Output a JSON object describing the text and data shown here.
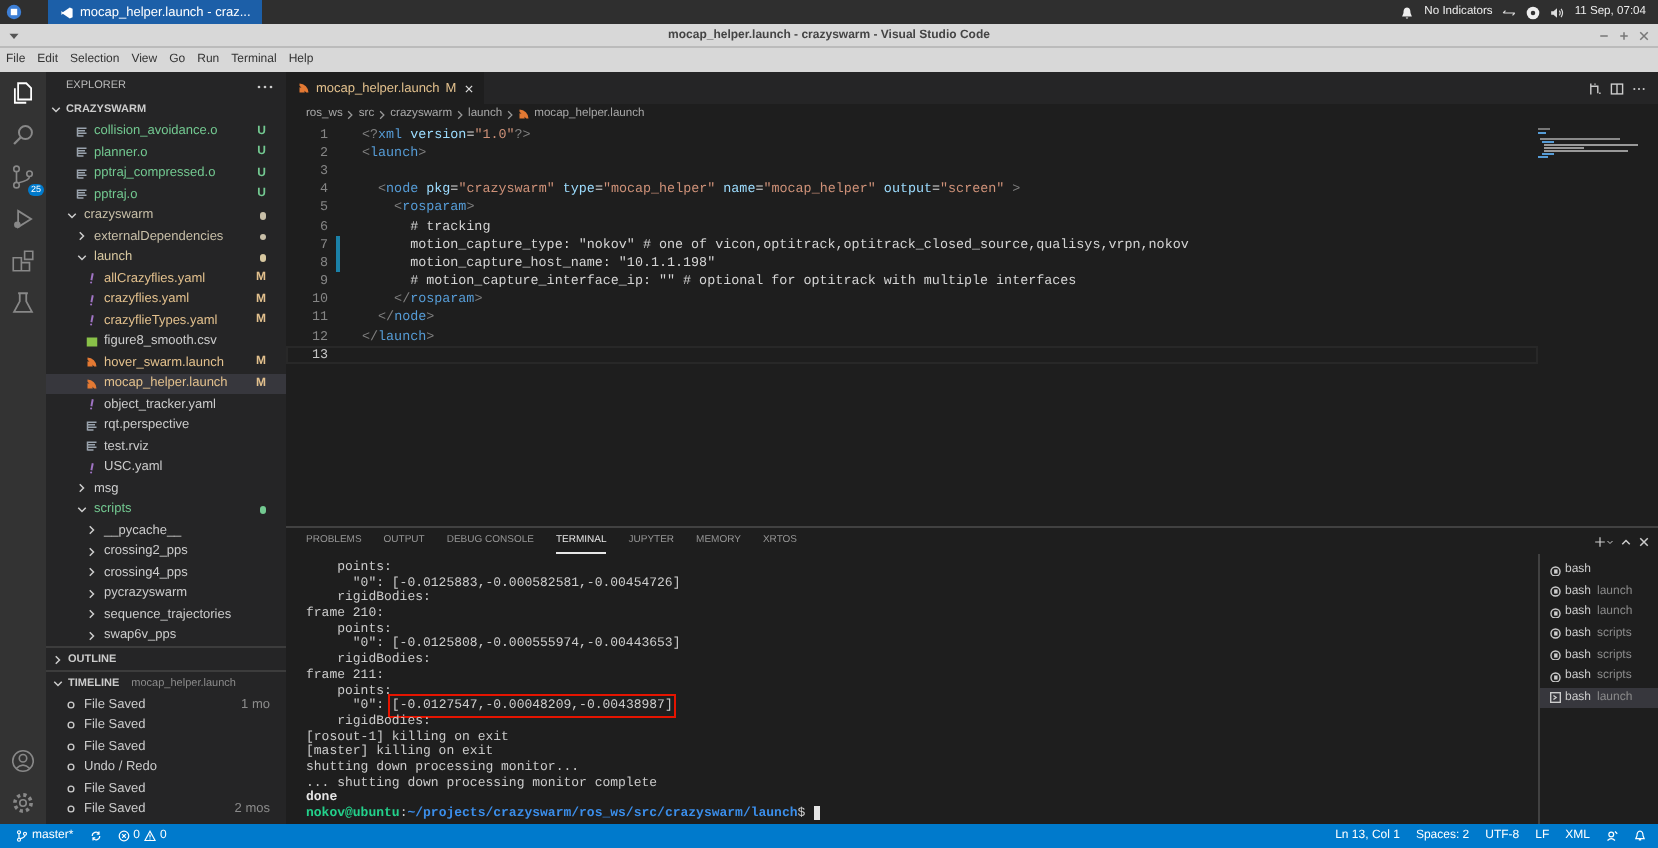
{
  "top_panel": {
    "taskbar_item": "mocap_helper.launch - craz...",
    "indicators": "No Indicators",
    "clock": "11 Sep, 07:04"
  },
  "window": {
    "title": "mocap_helper.launch - crazyswarm - Visual Studio Code"
  },
  "menu": [
    "File",
    "Edit",
    "Selection",
    "View",
    "Go",
    "Run",
    "Terminal",
    "Help"
  ],
  "activity_bar": {
    "source_control_badge": "25"
  },
  "explorer": {
    "title": "EXPLORER",
    "root": {
      "label": "CRAZYSWARM",
      "expanded": true
    },
    "tree": [
      {
        "children": [
          {
            "label": "collision_avoidance.o",
            "kind": "object",
            "badge": "U",
            "color": "#73c991",
            "selected": false
          },
          {
            "label": "planner.o",
            "kind": "object",
            "badge": "U",
            "color": "#73c991",
            "selected": false
          },
          {
            "label": "pptraj_compressed.o",
            "kind": "object",
            "badge": "U",
            "color": "#73c991",
            "selected": false
          },
          {
            "label": "pptraj.o",
            "kind": "object",
            "badge": "U",
            "color": "#73c991",
            "selected": false
          }
        ]
      },
      {
        "label": "crazyswarm",
        "kind": "folder",
        "expanded": true,
        "dot": true,
        "color": "#c8bfa8",
        "selected": false,
        "children": [
          {
            "label": "externalDependencies",
            "kind": "folder",
            "expanded": false,
            "dot": true,
            "color": "#c8bfa8",
            "selected": false
          },
          {
            "label": "launch",
            "kind": "folder",
            "expanded": true,
            "dot": true,
            "color": "#d8c8a0",
            "selected": false,
            "children": [
              {
                "label": "allCrazyflies.yaml",
                "kind": "yaml",
                "badge": "M",
                "color": "#e2c08d",
                "selected": false
              },
              {
                "label": "crazyflies.yaml",
                "kind": "yaml",
                "badge": "M",
                "color": "#e2c08d",
                "selected": false
              },
              {
                "label": "crazyflieTypes.yaml",
                "kind": "yaml",
                "badge": "M",
                "color": "#e2c08d",
                "selected": false
              },
              {
                "label": "figure8_smooth.csv",
                "kind": "csv",
                "selected": false
              },
              {
                "label": "hover_swarm.launch",
                "kind": "launch",
                "badge": "M",
                "color": "#e2c08d",
                "selected": false
              },
              {
                "label": "mocap_helper.launch",
                "kind": "launch",
                "badge": "M",
                "color": "#e2c08d",
                "selected": true
              },
              {
                "label": "object_tracker.yaml",
                "kind": "yaml",
                "selected": false
              },
              {
                "label": "rqt.perspective",
                "kind": "object",
                "selected": false
              },
              {
                "label": "test.rviz",
                "kind": "object",
                "selected": false
              },
              {
                "label": "USC.yaml",
                "kind": "yaml",
                "selected": false
              }
            ]
          },
          {
            "label": "msg",
            "kind": "folder",
            "expanded": false,
            "selected": false
          },
          {
            "label": "scripts",
            "kind": "folder",
            "expanded": true,
            "dot": true,
            "color": "#73c991",
            "selected": false,
            "children": [
              {
                "label": "__pycache__",
                "kind": "folder",
                "expanded": false,
                "selected": false
              },
              {
                "label": "crossing2_pps",
                "kind": "folder",
                "expanded": false,
                "selected": false
              },
              {
                "label": "crossing4_pps",
                "kind": "folder",
                "expanded": false,
                "selected": false
              },
              {
                "label": "pycrazyswarm",
                "kind": "folder",
                "expanded": false,
                "selected": false
              },
              {
                "label": "sequence_trajectories",
                "kind": "folder",
                "expanded": false,
                "selected": false
              },
              {
                "label": "swap6v_pps",
                "kind": "folder",
                "expanded": false,
                "selected": false
              }
            ]
          }
        ]
      }
    ]
  },
  "outline": {
    "title": "OUTLINE",
    "expanded": false
  },
  "timeline": {
    "title": "TIMELINE",
    "file": "mocap_helper.launch",
    "expanded": true,
    "items": [
      {
        "label": "File Saved",
        "age": "1 mo"
      },
      {
        "label": "File Saved"
      },
      {
        "label": "File Saved"
      },
      {
        "label": "Undo / Redo"
      },
      {
        "label": "File Saved"
      },
      {
        "label": "File Saved",
        "age": "2 mos"
      }
    ]
  },
  "editor": {
    "tab": {
      "label": "mocap_helper.launch",
      "badge": "M"
    },
    "breadcrumbs": [
      "ros_ws",
      "src",
      "crazyswarm",
      "launch",
      "mocap_helper.launch"
    ],
    "lines": [
      {
        "n": "1",
        "modified": false,
        "current": false,
        "tokens": [
          {
            "kind": "punct",
            "text": "<?"
          },
          {
            "kind": "tag",
            "text": "xml"
          },
          {
            "kind": "attr",
            "text": " version"
          },
          {
            "kind": "text",
            "text": "="
          },
          {
            "kind": "str",
            "text": "\"1.0\""
          },
          {
            "kind": "punct",
            "text": "?>"
          }
        ]
      },
      {
        "n": "2",
        "modified": false,
        "current": false,
        "tokens": [
          {
            "kind": "punct",
            "text": "<"
          },
          {
            "kind": "tag",
            "text": "launch"
          },
          {
            "kind": "punct",
            "text": ">"
          }
        ]
      },
      {
        "n": "3",
        "modified": false,
        "current": false
      },
      {
        "n": "4",
        "modified": false,
        "current": false,
        "tokens": [
          {
            "kind": "punct",
            "text": "  <"
          },
          {
            "kind": "tag",
            "text": "node"
          },
          {
            "kind": "attr",
            "text": " pkg"
          },
          {
            "kind": "text",
            "text": "="
          },
          {
            "kind": "str",
            "text": "\"crazyswarm\""
          },
          {
            "kind": "attr",
            "text": " type"
          },
          {
            "kind": "text",
            "text": "="
          },
          {
            "kind": "str",
            "text": "\"mocap_helper\""
          },
          {
            "kind": "attr",
            "text": " name"
          },
          {
            "kind": "text",
            "text": "="
          },
          {
            "kind": "str",
            "text": "\"mocap_helper\""
          },
          {
            "kind": "attr",
            "text": " output"
          },
          {
            "kind": "text",
            "text": "="
          },
          {
            "kind": "str",
            "text": "\"screen\""
          },
          {
            "kind": "punct",
            "text": " >"
          }
        ]
      },
      {
        "n": "5",
        "modified": false,
        "current": false,
        "tokens": [
          {
            "kind": "punct",
            "text": "    <"
          },
          {
            "kind": "tag",
            "text": "rosparam"
          },
          {
            "kind": "punct",
            "text": ">"
          }
        ]
      },
      {
        "n": "6",
        "modified": false,
        "current": false,
        "tokens": [
          {
            "kind": "text",
            "text": "      # tracking"
          }
        ]
      },
      {
        "n": "7",
        "modified": true,
        "current": false,
        "tokens": [
          {
            "kind": "text",
            "text": "      motion_capture_type: \"nokov\" # one of vicon,optitrack,optitrack_closed_source,qualisys,vrpn,nokov"
          }
        ]
      },
      {
        "n": "8",
        "modified": true,
        "current": false,
        "tokens": [
          {
            "kind": "text",
            "text": "      motion_capture_host_name: \"10.1.1.198\""
          }
        ]
      },
      {
        "n": "9",
        "modified": false,
        "current": false,
        "tokens": [
          {
            "kind": "text",
            "text": "      # motion_capture_interface_ip: \"\" # optional for optitrack with multiple interfaces"
          }
        ]
      },
      {
        "n": "10",
        "modified": false,
        "current": false,
        "tokens": [
          {
            "kind": "punct",
            "text": "    </"
          },
          {
            "kind": "tag",
            "text": "rosparam"
          },
          {
            "kind": "punct",
            "text": ">"
          }
        ]
      },
      {
        "n": "11",
        "modified": false,
        "current": false,
        "tokens": [
          {
            "kind": "punct",
            "text": "  </"
          },
          {
            "kind": "tag",
            "text": "node"
          },
          {
            "kind": "punct",
            "text": ">"
          }
        ]
      },
      {
        "n": "12",
        "modified": false,
        "current": false,
        "tokens": [
          {
            "kind": "punct",
            "text": "</"
          },
          {
            "kind": "tag",
            "text": "launch"
          },
          {
            "kind": "punct",
            "text": ">"
          }
        ]
      },
      {
        "n": "13",
        "modified": false,
        "current": true
      }
    ]
  },
  "panel": {
    "tabs": [
      {
        "label": "PROBLEMS",
        "selected": false
      },
      {
        "label": "OUTPUT",
        "selected": false
      },
      {
        "label": "DEBUG CONSOLE",
        "selected": false
      },
      {
        "label": "TERMINAL",
        "selected": true
      },
      {
        "label": "JUPYTER",
        "selected": false
      },
      {
        "label": "MEMORY",
        "selected": false
      },
      {
        "label": "XRTOS",
        "selected": false
      }
    ],
    "terminal_lines": [
      [
        {
          "kind": "text",
          "text": "    points:"
        }
      ],
      [
        {
          "kind": "text",
          "text": "      \"0\": [-0.0125883,-0.000582581,-0.00454726]"
        }
      ],
      [
        {
          "kind": "text",
          "text": "    rigidBodies:"
        }
      ],
      [
        {
          "kind": "text",
          "text": "frame 210:"
        }
      ],
      [
        {
          "kind": "text",
          "text": "    points:"
        }
      ],
      [
        {
          "kind": "text",
          "text": "      \"0\": [-0.0125808,-0.000555974,-0.00443653]"
        }
      ],
      [
        {
          "kind": "text",
          "text": "    rigidBodies:"
        }
      ],
      [
        {
          "kind": "text",
          "text": "frame 211:"
        }
      ],
      [
        {
          "kind": "text",
          "text": "    points:"
        }
      ],
      [
        {
          "kind": "text",
          "text": "      \"0\": "
        },
        {
          "kind": "boxed",
          "text": "[-0.0127547,-0.00048209,-0.00438987]"
        }
      ],
      [
        {
          "kind": "text",
          "text": "    rigidBodies:"
        }
      ],
      [
        {
          "kind": "text",
          "text": "[rosout-1] killing on exit"
        }
      ],
      [
        {
          "kind": "text",
          "text": "[master] killing on exit"
        }
      ],
      [
        {
          "kind": "text",
          "text": "shutting down processing monitor..."
        }
      ],
      [
        {
          "kind": "text",
          "text": "... shutting down processing monitor complete"
        }
      ],
      [
        {
          "kind": "bold",
          "text": "done"
        }
      ],
      [
        {
          "kind": "user",
          "text": "nokov@ubuntu"
        },
        {
          "kind": "text",
          "text": ":"
        },
        {
          "kind": "path",
          "text": "~/projects/crazyswarm/ros_ws/src/crazyswarm/launch"
        },
        {
          "kind": "text",
          "text": "$ "
        },
        {
          "kind": "cursor"
        }
      ]
    ],
    "terminals": [
      {
        "name": "bash",
        "selected": false
      },
      {
        "name": "bash",
        "folder": "launch",
        "selected": false
      },
      {
        "name": "bash",
        "folder": "launch",
        "selected": false
      },
      {
        "name": "bash",
        "folder": "scripts",
        "selected": false
      },
      {
        "name": "bash",
        "folder": "scripts",
        "selected": false
      },
      {
        "name": "bash",
        "folder": "scripts",
        "selected": false
      },
      {
        "name": "bash",
        "folder": "launch",
        "selected": true
      }
    ]
  },
  "status_bar": {
    "branch": "master*",
    "errors": "0",
    "warnings": "0",
    "right": [
      "Ln 13, Col 1",
      "Spaces: 2",
      "UTF-8",
      "LF",
      "XML"
    ]
  }
}
